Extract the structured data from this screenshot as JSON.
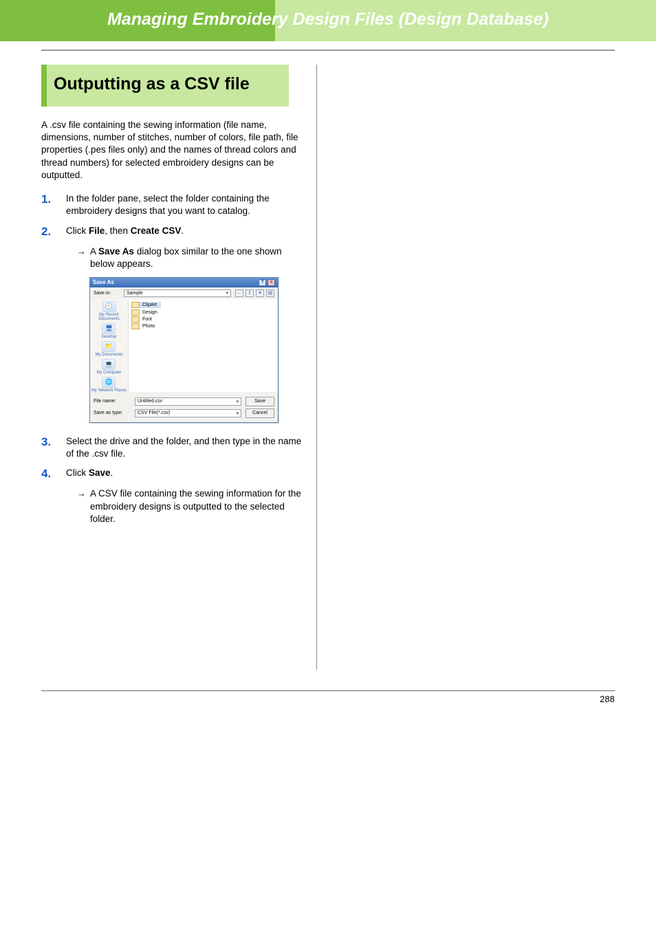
{
  "header": {
    "title": "Managing Embroidery Design Files (Design Database)"
  },
  "section": {
    "heading": "Outputting as a CSV file"
  },
  "intro": "A .csv file containing the sewing information (file name, dimensions, number of stitches, number of colors, file path, file properties (.pes files only) and the names of thread colors and thread numbers) for selected embroidery designs can be outputted.",
  "steps": {
    "s1": {
      "num": "1.",
      "text": "In the folder pane, select the folder containing the embroidery designs that you want to catalog."
    },
    "s2": {
      "num": "2.",
      "prefix": "Click ",
      "menu1": "File",
      "mid": ", then ",
      "menu2": "Create CSV",
      "suffix": ".",
      "sub_prefix": "A ",
      "sub_bold": "Save As",
      "sub_suffix": " dialog box similar to the one shown below appears."
    },
    "s3": {
      "num": "3.",
      "text": "Select the drive and the folder, and then type in the name of the .csv file."
    },
    "s4": {
      "num": "4.",
      "prefix": "Click ",
      "action": "Save",
      "suffix": ".",
      "sub": "A CSV file containing the sewing information for the embroidery designs is outputted to the selected folder."
    }
  },
  "dialog": {
    "title": "Save As",
    "savein_label": "Save in:",
    "savein_value": "Sample",
    "places": {
      "recent": "My Recent Documents",
      "desktop": "Desktop",
      "mydocs": "My Documents",
      "mycomp": "My Computer",
      "mynet": "My Network Places"
    },
    "folders": {
      "f1": "ClipArt",
      "f2": "Design",
      "f3": "Font",
      "f4": "Photo"
    },
    "fn_label": "File name:",
    "fn_value": "Untitled.csv",
    "ft_label": "Save as type:",
    "ft_value": "CSV File(*.csv)",
    "btn_save": "Save",
    "btn_cancel": "Cancel"
  },
  "page_number": "288"
}
